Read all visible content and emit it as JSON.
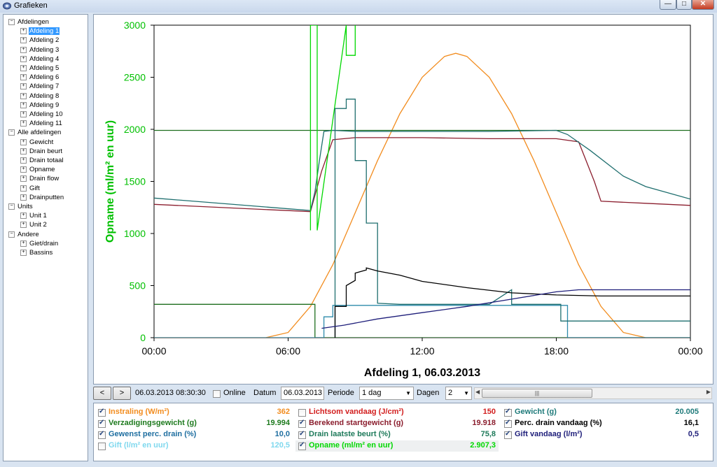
{
  "window": {
    "title": "Grafieken"
  },
  "tree": [
    {
      "label": "Afdelingen",
      "depth": 0,
      "expander": "−"
    },
    {
      "label": "Afdeling 1",
      "depth": 1,
      "expander": "+",
      "selected": true
    },
    {
      "label": "Afdeling 2",
      "depth": 1,
      "expander": "+"
    },
    {
      "label": "Afdeling 3",
      "depth": 1,
      "expander": "+"
    },
    {
      "label": "Afdeling 4",
      "depth": 1,
      "expander": "+"
    },
    {
      "label": "Afdeling 5",
      "depth": 1,
      "expander": "+"
    },
    {
      "label": "Afdeling 6",
      "depth": 1,
      "expander": "+"
    },
    {
      "label": "Afdeling 7",
      "depth": 1,
      "expander": "+"
    },
    {
      "label": "Afdeling 8",
      "depth": 1,
      "expander": "+"
    },
    {
      "label": "Afdeling 9",
      "depth": 1,
      "expander": "+"
    },
    {
      "label": "Afdeling 10",
      "depth": 1,
      "expander": "+"
    },
    {
      "label": "Afdeling 11",
      "depth": 1,
      "expander": "+"
    },
    {
      "label": "Alle afdelingen",
      "depth": 0,
      "expander": "−"
    },
    {
      "label": "Gewicht",
      "depth": 1,
      "expander": "+"
    },
    {
      "label": "Drain beurt",
      "depth": 1,
      "expander": "+"
    },
    {
      "label": "Drain totaal",
      "depth": 1,
      "expander": "+"
    },
    {
      "label": "Opname",
      "depth": 1,
      "expander": "+"
    },
    {
      "label": "Drain flow",
      "depth": 1,
      "expander": "+"
    },
    {
      "label": "Gift",
      "depth": 1,
      "expander": "+"
    },
    {
      "label": "Drainputten",
      "depth": 1,
      "expander": "+"
    },
    {
      "label": "Units",
      "depth": 0,
      "expander": "−"
    },
    {
      "label": "Unit 1",
      "depth": 1,
      "expander": "+"
    },
    {
      "label": "Unit 2",
      "depth": 1,
      "expander": "+"
    },
    {
      "label": "Andere",
      "depth": 0,
      "expander": "−"
    },
    {
      "label": "Giet/drain",
      "depth": 1,
      "expander": "+"
    },
    {
      "label": "Bassins",
      "depth": 1,
      "expander": "+"
    }
  ],
  "toolbar": {
    "prev_label": "<",
    "next_label": ">",
    "current_datetime": "06.03.2013 08:30:30",
    "online_label": "Online",
    "online_checked": false,
    "datum_label": "Datum",
    "datum_value": "06.03.2013",
    "periode_label": "Periode",
    "periode_value": "1 dag",
    "dagen_label": "Dagen",
    "dagen_value": "2"
  },
  "chart_data": {
    "type": "line",
    "title": "Afdeling 1, 06.03.2013",
    "ylabel": "Opname (ml/m² en uur)",
    "xlabel": "",
    "xlim": [
      0,
      24
    ],
    "ylim": [
      0,
      3000
    ],
    "x_ticks": [
      "00:00",
      "06:00",
      "12:00",
      "18:00",
      "00:00"
    ],
    "x_tick_values": [
      0,
      6,
      12,
      18,
      24
    ],
    "y_ticks": [
      0,
      500,
      1000,
      1500,
      2000,
      2500,
      3000
    ],
    "grid": false,
    "series": [
      {
        "name": "Instraling (W/m²)",
        "color": "#f28c1e",
        "x": [
          0,
          5,
          6,
          7,
          8,
          9,
          10,
          11,
          12,
          13,
          13.5,
          14,
          15,
          16,
          17,
          18,
          19,
          20,
          21,
          22,
          24
        ],
        "y": [
          0,
          0,
          50,
          300,
          700,
          1200,
          1700,
          2150,
          2500,
          2700,
          2730,
          2700,
          2500,
          2150,
          1700,
          1200,
          700,
          300,
          50,
          0,
          0
        ]
      },
      {
        "name": "Verzadigingsgewicht (g)",
        "color": "#1e6e1e",
        "x": [
          0,
          24
        ],
        "y": [
          1990,
          1990
        ]
      },
      {
        "name": "Gewenst perc. drain (%)",
        "color": "#1e6e1e",
        "x": [
          0,
          7.2,
          7.2,
          24
        ],
        "y": [
          320,
          320,
          0,
          0
        ]
      },
      {
        "name": "Gift (l/m² en uur)",
        "color": "#2e8bab",
        "x": [
          0,
          7.6,
          7.6,
          8.0,
          8.0,
          18.5,
          18.5,
          24
        ],
        "y": [
          0,
          0,
          200,
          200,
          310,
          310,
          0,
          0
        ]
      },
      {
        "name": "Berekend startgewicht (g)",
        "color": "#8b1e2e",
        "x": [
          0,
          7,
          7.5,
          8,
          9,
          12,
          15,
          18,
          19,
          19.7,
          20,
          22,
          24
        ],
        "y": [
          1280,
          1210,
          1600,
          1900,
          1920,
          1920,
          1910,
          1910,
          1880,
          1500,
          1310,
          1290,
          1270
        ]
      },
      {
        "name": "Drain laatste beurt (%)",
        "color": "#1e6e6e",
        "x": [
          0,
          7,
          7.2,
          7.4,
          7.6,
          8,
          9,
          12,
          15,
          18,
          18.5,
          19.5,
          21,
          22,
          24
        ],
        "y": [
          1340,
          1220,
          1400,
          1700,
          1980,
          1990,
          1980,
          1980,
          1980,
          1990,
          1950,
          1800,
          1550,
          1450,
          1330
        ]
      },
      {
        "name": "Opname (ml/m² en uur)",
        "color": "#00d800",
        "x": [
          7.0,
          7.0,
          7.3,
          7.3,
          7.3,
          8.6,
          8.6,
          9.0,
          9.0
        ],
        "y": [
          1030,
          3000,
          3000,
          1030,
          1030,
          3000,
          2710,
          2710,
          3000
        ]
      },
      {
        "name": "Gewicht (g)",
        "color": "#1e6e6e",
        "x": [
          8.1,
          8.1,
          8.6,
          8.6,
          9.0,
          9.0,
          9.5,
          9.5,
          10.0,
          10.0,
          11,
          13,
          15,
          16,
          16,
          18.2,
          18.2,
          24
        ],
        "y": [
          0,
          2200,
          2200,
          2290,
          2290,
          1700,
          1700,
          1100,
          1100,
          330,
          320,
          320,
          320,
          460,
          320,
          320,
          160,
          160
        ]
      },
      {
        "name": "Perc. drain vandaag (%)",
        "color": "#000000",
        "x": [
          8.1,
          8.1,
          8.6,
          8.6,
          9.0,
          9.0,
          9.5,
          9.5,
          10,
          11,
          12,
          14,
          16,
          18,
          20,
          24
        ],
        "y": [
          0,
          300,
          300,
          500,
          550,
          620,
          650,
          670,
          640,
          600,
          540,
          480,
          430,
          410,
          400,
          400
        ]
      },
      {
        "name": "Gift vandaag (l/m²)",
        "color": "#1e1e7a",
        "x": [
          7.5,
          8.5,
          10,
          12,
          14,
          16,
          18,
          19,
          21,
          24
        ],
        "y": [
          90,
          120,
          180,
          240,
          300,
          370,
          440,
          460,
          460,
          460
        ]
      }
    ]
  },
  "legend": [
    {
      "name": "Instraling (W/m²)",
      "value": "362",
      "color": "#f28c1e",
      "checked": true
    },
    {
      "name": "Verzadigingsgewicht (g)",
      "value": "19.994",
      "color": "#1e7a1e",
      "checked": true
    },
    {
      "name": "Gewenst perc. drain (%)",
      "value": "10,0",
      "color": "#1e6ea0",
      "checked": true
    },
    {
      "name": "Gift (l/m² en uur)",
      "value": "120,5",
      "color": "#7fd8ee",
      "checked": false
    },
    {
      "name": "Lichtsom vandaag (J/cm²)",
      "value": "150",
      "color": "#d21e1e",
      "checked": false
    },
    {
      "name": "Berekend startgewicht (g)",
      "value": "19.918",
      "color": "#8b1e2e",
      "checked": true
    },
    {
      "name": "Drain laatste beurt (%)",
      "value": "75,8",
      "color": "#1e7a5a",
      "checked": true
    },
    {
      "name": "Opname (ml/m² en uur)",
      "value": "2.907,3",
      "color": "#00d800",
      "checked": true
    },
    {
      "name": "Gewicht (g)",
      "value": "20.005",
      "color": "#1e7a7a",
      "checked": true
    },
    {
      "name": "Perc. drain vandaag (%)",
      "value": "16,1",
      "color": "#000000",
      "checked": true
    },
    {
      "name": "Gift vandaag (l/m²)",
      "value": "0,5",
      "color": "#1e1e7a",
      "checked": true
    }
  ]
}
